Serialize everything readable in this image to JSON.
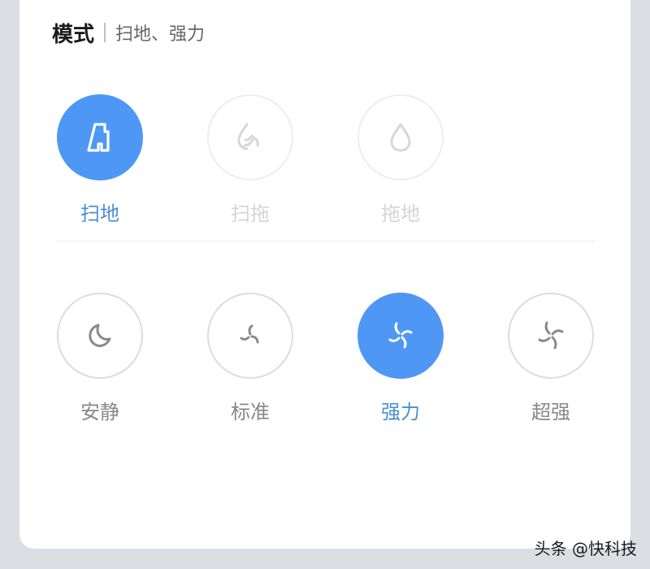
{
  "header": {
    "title": "模式",
    "subtitle": "扫地、强力"
  },
  "mode_options": [
    {
      "label": "扫地",
      "state": "active"
    },
    {
      "label": "扫拖",
      "state": "disabled"
    },
    {
      "label": "拖地",
      "state": "disabled"
    }
  ],
  "power_options": [
    {
      "label": "安静",
      "state": "normal"
    },
    {
      "label": "标准",
      "state": "normal"
    },
    {
      "label": "强力",
      "state": "active"
    },
    {
      "label": "超强",
      "state": "normal"
    }
  ],
  "watermark": "头条 @快科技",
  "colors": {
    "accent": "#4f97f5",
    "active_label": "#4a8fd6",
    "icon_normal": "#8a8a8a",
    "icon_disabled": "#d7d7d7"
  },
  "icons": {
    "sweep": "broom-icon",
    "sweep_mop": "sweep-mop-icon",
    "mop": "water-drop-icon",
    "quiet": "moon-icon",
    "standard": "fan-small-icon",
    "strong": "fan-icon",
    "max": "fan-large-icon"
  }
}
